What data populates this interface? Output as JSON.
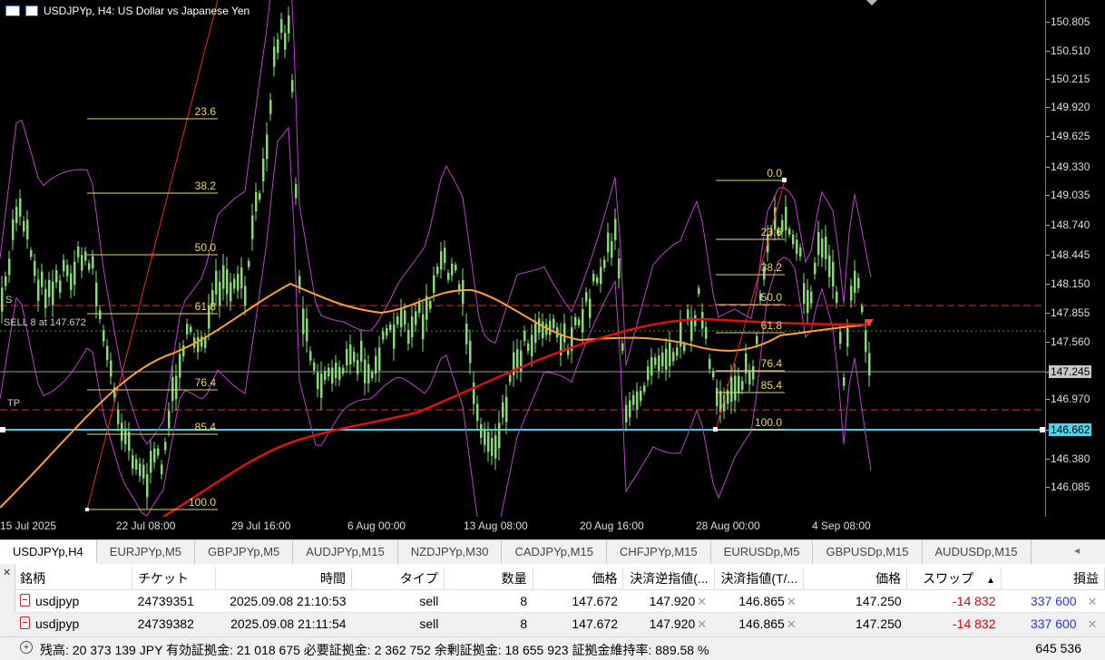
{
  "chart": {
    "title": "USDJPYp, H4:  US Dollar vs Japanese Yen",
    "price_ticks": [
      "150.805",
      "150.510",
      "150.215",
      "149.920",
      "149.625",
      "149.330",
      "149.035",
      "148.740",
      "148.445",
      "148.150",
      "147.855",
      "147.560",
      "147.245",
      "146.970",
      "146.662",
      "146.380",
      "146.085"
    ],
    "current_price": "147.245",
    "tp_price": "146.662",
    "sell_label": "SELL 8 at 147.672",
    "s_label": "S",
    "tp_label": "TP",
    "time_ticks": [
      "15 Jul 2025",
      "22 Jul 08:00",
      "29 Jul 16:00",
      "6 Aug 00:00",
      "13 Aug 08:00",
      "20 Aug 16:00",
      "28 Aug 00:00",
      "4 Sep 08:00"
    ],
    "fib1_levels": [
      "23.6",
      "38.2",
      "50.0",
      "61.8",
      "76.4",
      "85.4",
      "100.0"
    ],
    "fib2_levels": [
      "0.0",
      "23.6",
      "38.2",
      "50.0",
      "61.8",
      "76.4",
      "85.4",
      "100.0"
    ],
    "colors": {
      "candle": "#7ee26a",
      "band": "#c040d0",
      "ma_orange": "#ffa030",
      "ma_red": "#e01010",
      "fib": "#e8d870",
      "tp_line": "#40d0e8",
      "level": "#e03030"
    }
  },
  "tabs": [
    "USDJPYp,H4",
    "EURJPYp,M5",
    "GBPJPYp,M5",
    "AUDJPYp,M15",
    "NZDJPYp,M30",
    "CADJPYp,M15",
    "CHFJPYp,M15",
    "EURUSDp,M5",
    "GBPUSDp,M15",
    "AUDUSDp,M15"
  ],
  "tab_scroll_icon": "arrow-left-icon",
  "terminal": {
    "headers": [
      "銘柄",
      "チケット",
      "時間",
      "タイプ",
      "数量",
      "価格",
      "決済逆指値(...",
      "決済指値(T/...",
      "価格",
      "スワップ",
      "損益"
    ],
    "sort_indicator": "▲",
    "rows": [
      {
        "symbol": "usdjpyp",
        "ticket": "24739351",
        "time": "2025.09.08 21:10:53",
        "type": "sell",
        "volume": "8",
        "price": "147.672",
        "sl": "147.920",
        "tp": "146.865",
        "current": "147.250",
        "swap": "-14 832",
        "profit": "337 600"
      },
      {
        "symbol": "usdjpyp",
        "ticket": "24739382",
        "time": "2025.09.08 21:11:54",
        "type": "sell",
        "volume": "8",
        "price": "147.672",
        "sl": "147.920",
        "tp": "146.865",
        "current": "147.250",
        "swap": "-14 832",
        "profit": "337 600"
      }
    ],
    "summary": "残高: 20 373 139 JPY  有効証拠金: 21 018 675  必要証拠金: 2 362 752  余剰証拠金: 18 655 923  証拠金維持率: 889.58 %",
    "summary_total": "645 536"
  }
}
